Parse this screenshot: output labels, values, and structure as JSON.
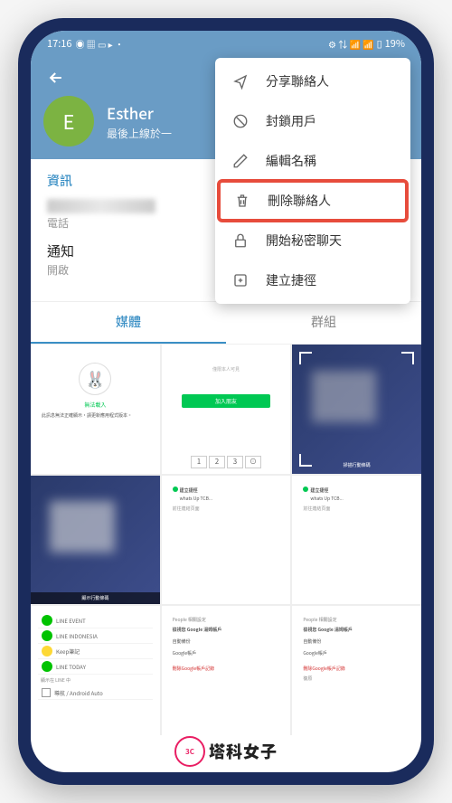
{
  "status_bar": {
    "time": "17:16",
    "battery_percent": "19%"
  },
  "profile": {
    "avatar_letter": "E",
    "name": "Esther",
    "last_seen": "最後上線於一"
  },
  "menu": {
    "share_contact": "分享聯絡人",
    "block_user": "封鎖用戶",
    "edit_name": "編輯名稱",
    "delete_contact": "刪除聯絡人",
    "start_secret_chat": "開始秘密聊天",
    "create_shortcut": "建立捷徑"
  },
  "info": {
    "section_label": "資訊",
    "phone_label": "電話",
    "notification_label": "通知",
    "notification_value": "開啟"
  },
  "tabs": {
    "media": "媒體",
    "groups": "群組"
  },
  "pager": {
    "p1": "1",
    "p2": "2",
    "p3": "3"
  },
  "watermark": {
    "badge": "3C",
    "text": "塔科女子"
  }
}
